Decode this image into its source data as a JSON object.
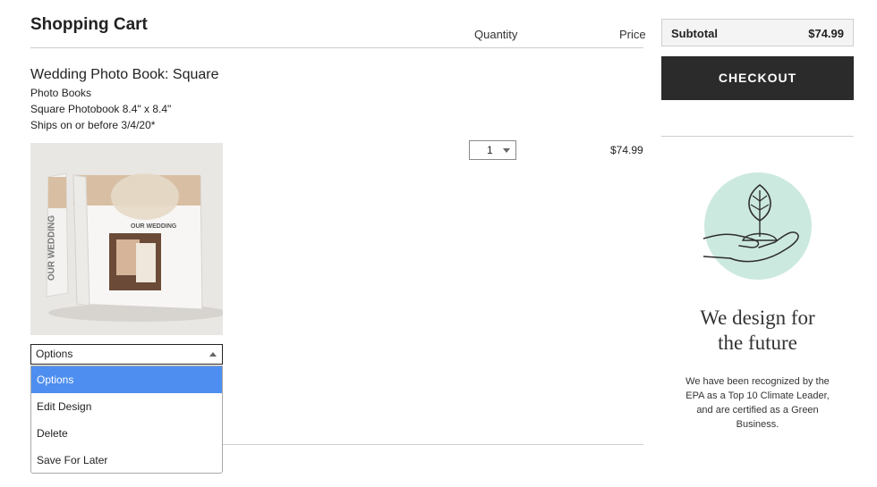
{
  "cart": {
    "title": "Shopping Cart",
    "columns": {
      "quantity": "Quantity",
      "price": "Price"
    }
  },
  "item": {
    "name": "Wedding Photo Book: Square",
    "details": [
      "Photo Books",
      "Square Photobook 8.4\" x 8.4\"",
      "Ships on or before 3/4/20*"
    ],
    "image": {
      "cover_text": "OUR WEDDING",
      "spine_text": "OUR WEDDING"
    },
    "quantity": "1",
    "price": "$74.99",
    "options": {
      "selected": "Options",
      "items": [
        "Options",
        "Edit Design",
        "Delete",
        "Save For Later"
      ]
    }
  },
  "summary": {
    "subtotal_label": "Subtotal",
    "subtotal_value": "$74.99",
    "checkout_label": "CHECKOUT"
  },
  "promo": {
    "icon": "plant-in-hand-icon",
    "title_line1": "We design for",
    "title_line2": "the future",
    "text": "We have been recognized by the EPA as a Top 10 Climate Leader, and are certified as a Green Business."
  },
  "colors": {
    "accent_blue": "#4e8ef0",
    "checkout_bg": "#2b2b2b",
    "leaf_circle": "#cce9df"
  }
}
